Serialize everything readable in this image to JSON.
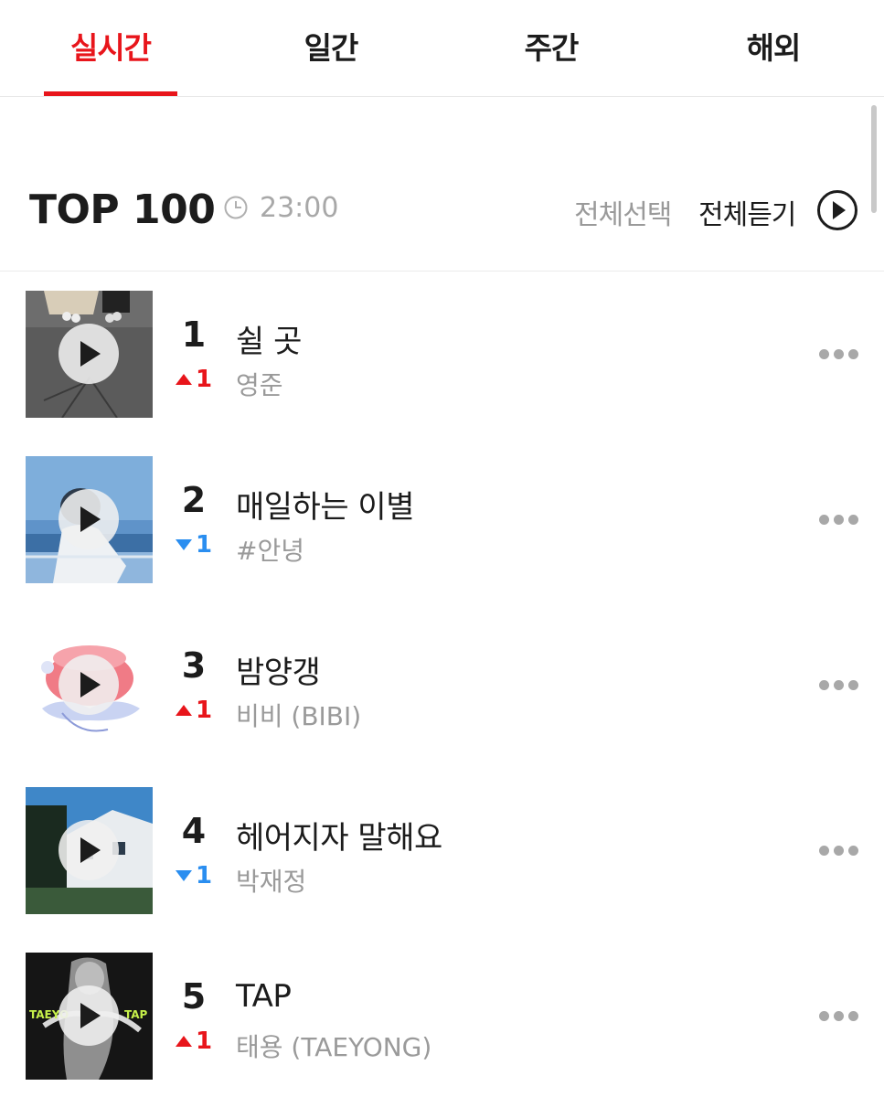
{
  "tabs": [
    {
      "label": "실시간",
      "active": true
    },
    {
      "label": "일간",
      "active": false
    },
    {
      "label": "주간",
      "active": false
    },
    {
      "label": "해외",
      "active": false
    }
  ],
  "header": {
    "title": "TOP 100",
    "time": "23:00",
    "select_all": "전체선택",
    "listen_all": "전체듣기"
  },
  "songs": [
    {
      "rank": "1",
      "change_dir": "up",
      "change": "1",
      "title": "쉴 곳",
      "artist": "영준"
    },
    {
      "rank": "2",
      "change_dir": "down",
      "change": "1",
      "title": "매일하는 이별",
      "artist": "#안녕"
    },
    {
      "rank": "3",
      "change_dir": "up",
      "change": "1",
      "title": "밤양갱",
      "artist": "비비 (BIBI)"
    },
    {
      "rank": "4",
      "change_dir": "down",
      "change": "1",
      "title": "헤어지자 말해요",
      "artist": "박재정"
    },
    {
      "rank": "5",
      "change_dir": "up",
      "change": "1",
      "title": "TAP",
      "artist": "태용 (TAEYONG)"
    }
  ],
  "colors": {
    "accent": "#e8151b",
    "up": "#e8151b",
    "down": "#2a8ef0"
  }
}
